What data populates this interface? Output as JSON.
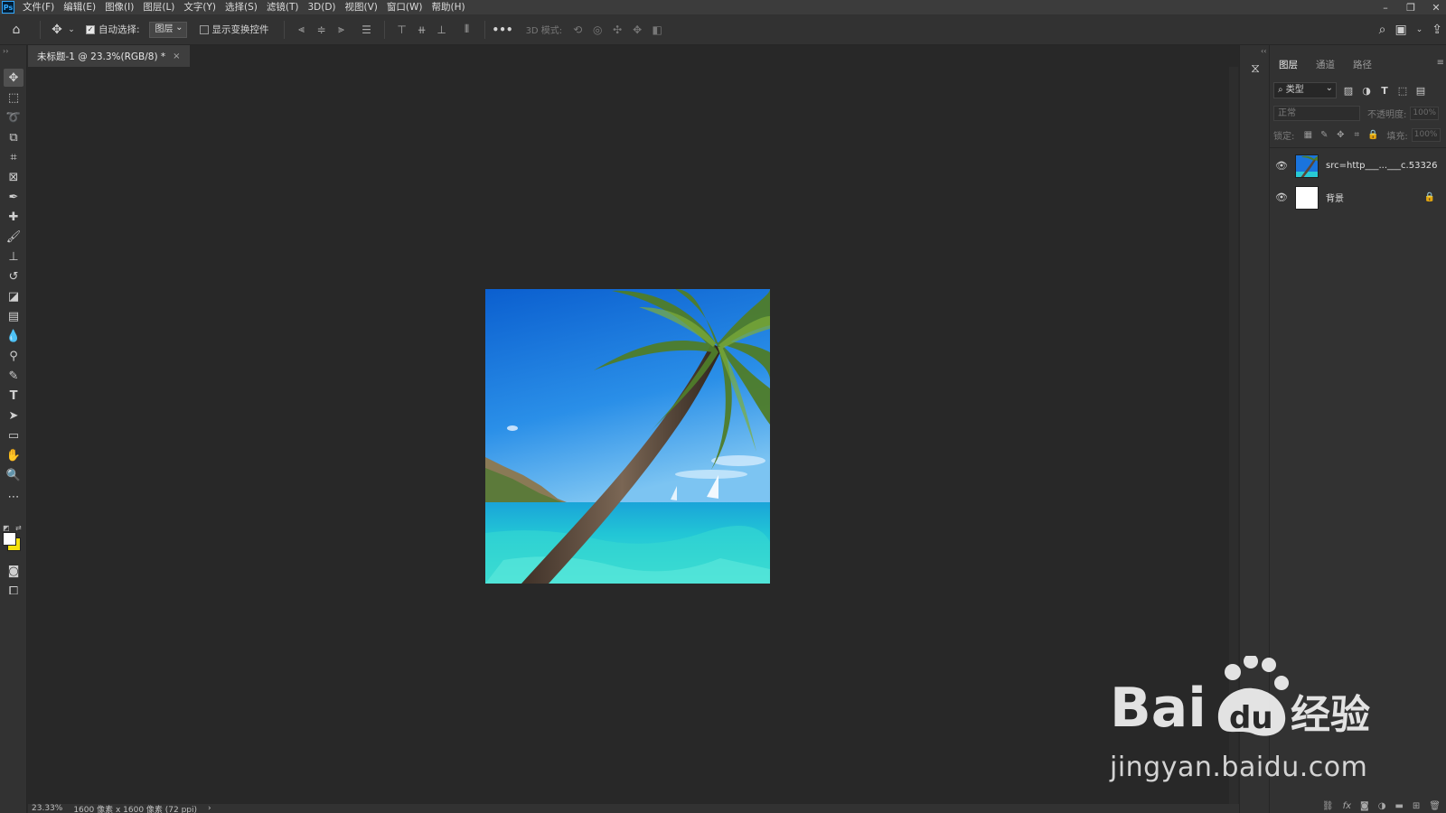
{
  "app": {
    "logo": "Ps"
  },
  "menubar": {
    "items": [
      "文件(F)",
      "编辑(E)",
      "图像(I)",
      "图层(L)",
      "文字(Y)",
      "选择(S)",
      "滤镜(T)",
      "3D(D)",
      "视图(V)",
      "窗口(W)",
      "帮助(H)"
    ],
    "window_controls": [
      "minimize-icon",
      "restore-icon",
      "close-icon"
    ]
  },
  "options": {
    "auto_select_label": "自动选择:",
    "auto_select_checked": true,
    "auto_select_target": "图层",
    "show_transform_label": "显示变换控件",
    "show_transform_checked": false,
    "more_label": "•••",
    "mode_3d_label": "3D 模式:"
  },
  "document": {
    "tab_title": "未标题-1 @ 23.3%(RGB/8) *",
    "close_glyph": "×"
  },
  "status": {
    "zoom": "23.33%",
    "doc_info": "1600 像素 x 1600 像素 (72 ppi)",
    "arrow": "›"
  },
  "layers_panel": {
    "tabs": [
      {
        "label": "图层",
        "active": true
      },
      {
        "label": "通道",
        "active": false
      },
      {
        "label": "路径",
        "active": false
      }
    ],
    "filter_label": "类型",
    "blend_mode": "正常",
    "opacity_label": "不透明度:",
    "opacity_value": "100%",
    "lock_label": "锁定:",
    "fill_label": "填充:",
    "fill_value": "100%",
    "layers": [
      {
        "name": "src=http___...___c.53326",
        "visible": true,
        "locked": false,
        "thumb": "beach"
      },
      {
        "name": "背景",
        "visible": true,
        "locked": true,
        "thumb": "white"
      }
    ]
  },
  "watermark": {
    "brand": "Bai du 经验",
    "url": "jingyan.baidu.com"
  },
  "colors": {
    "foreground": "#f5e10b",
    "background": "#ffffff",
    "ui_dark": "#282828",
    "ui_panel": "#323232"
  }
}
